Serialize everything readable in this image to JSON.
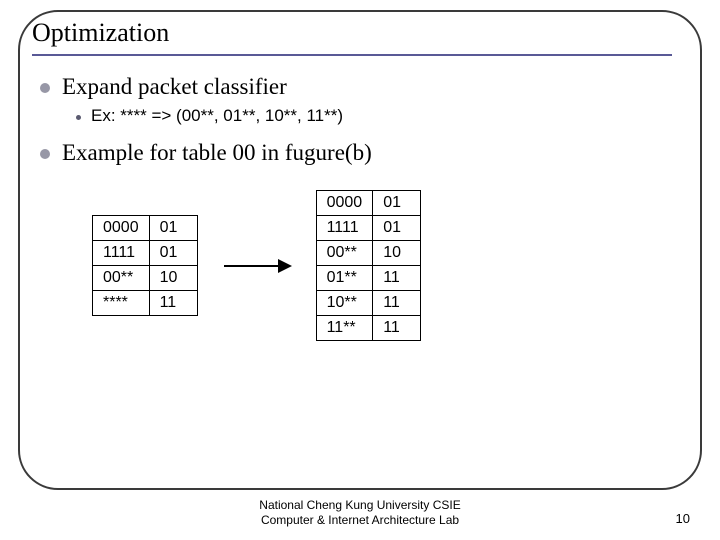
{
  "title": "Optimization",
  "bullets": [
    {
      "text": "Expand packet classifier",
      "sub": "Ex: **** => (00**, 01**, 10**, 11**)"
    },
    {
      "text": "Example for table 00 in fugure(b)"
    }
  ],
  "table_left": [
    [
      "0000",
      "01"
    ],
    [
      "1111",
      "01"
    ],
    [
      "00**",
      "10"
    ],
    [
      "****",
      "11"
    ]
  ],
  "table_right": [
    [
      "0000",
      "01"
    ],
    [
      "1111",
      "01"
    ],
    [
      "00**",
      "10"
    ],
    [
      "01**",
      "11"
    ],
    [
      "10**",
      "11"
    ],
    [
      "11**",
      "11"
    ]
  ],
  "footer": {
    "line1": "National Cheng Kung University CSIE",
    "line2": "Computer & Internet Architecture Lab"
  },
  "page_number": "10"
}
